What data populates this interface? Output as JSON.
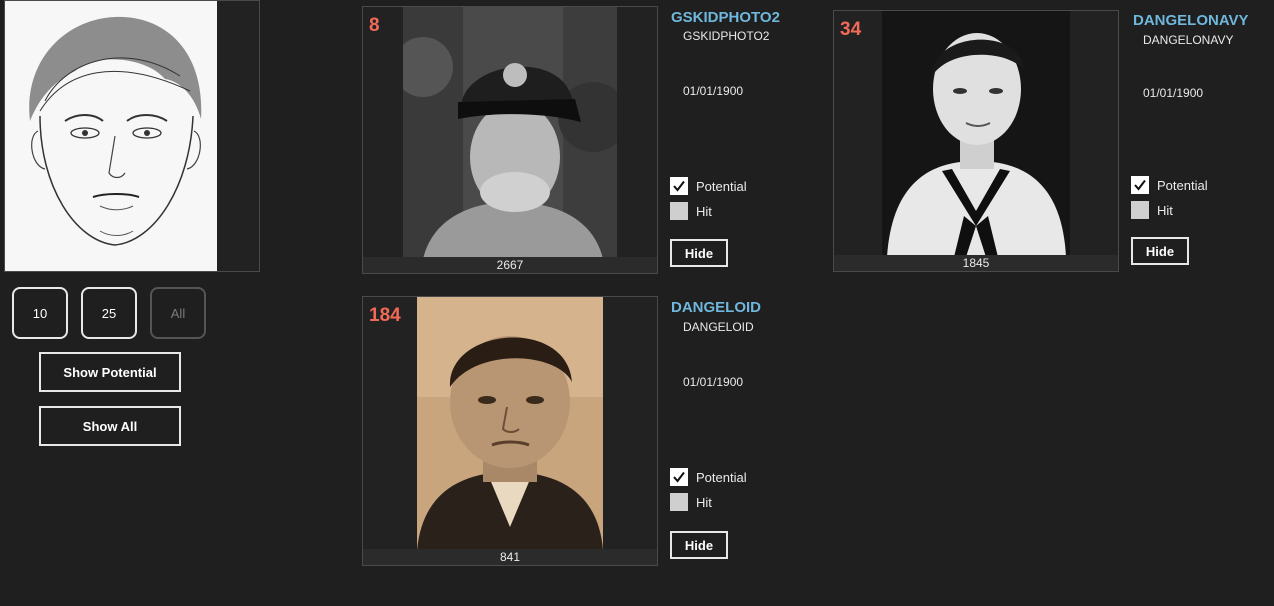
{
  "controls": {
    "count_buttons": [
      {
        "label": "10",
        "enabled": true
      },
      {
        "label": "25",
        "enabled": true
      },
      {
        "label": "All",
        "enabled": false
      }
    ],
    "show_potential_label": "Show Potential",
    "show_all_label": "Show All"
  },
  "results": [
    {
      "rank": "8",
      "name": "GSKIDPHOTO2",
      "subname": "GSKIDPHOTO2",
      "date": "01/01/1900",
      "score": "2667",
      "potential_label": "Potential",
      "potential_checked": true,
      "hit_label": "Hit",
      "hit_checked": false,
      "hide_label": "Hide"
    },
    {
      "rank": "34",
      "name": "DANGELONAVY",
      "subname": "DANGELONAVY",
      "date": "01/01/1900",
      "score": "1845",
      "potential_label": "Potential",
      "potential_checked": true,
      "hit_label": "Hit",
      "hit_checked": false,
      "hide_label": "Hide"
    },
    {
      "rank": "184",
      "name": "DANGELOID",
      "subname": "DANGELOID",
      "date": "01/01/1900",
      "score": "841",
      "potential_label": "Potential",
      "potential_checked": true,
      "hit_label": "Hit",
      "hit_checked": false,
      "hide_label": "Hide"
    }
  ],
  "colors": {
    "background": "#1f1f1f",
    "rank": "#f06a58",
    "name": "#6fb7dc"
  }
}
